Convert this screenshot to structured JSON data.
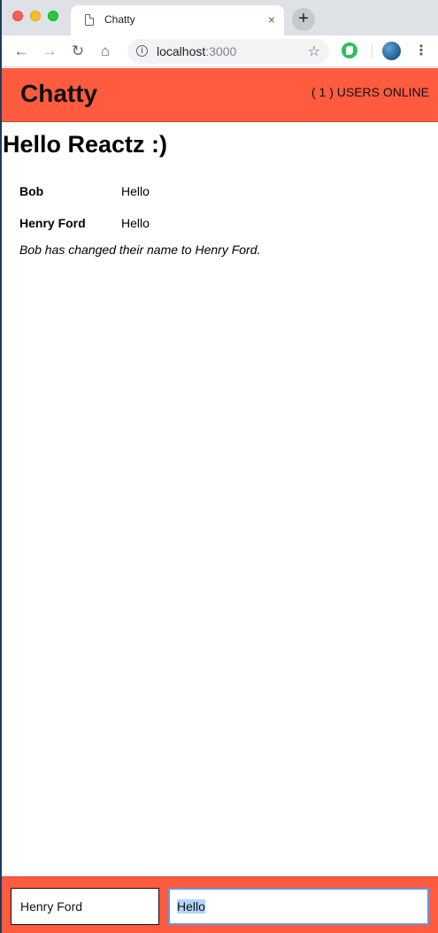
{
  "browser": {
    "tab_title": "Chatty",
    "tab_close": "×",
    "new_tab": "+",
    "url_host": "localhost",
    "url_port": ":3000"
  },
  "app": {
    "brand": "Chatty",
    "users_online": "( 1 ) USERS ONLINE",
    "heading": "Hello Reactz :)",
    "messages": [
      {
        "username": "Bob",
        "content": "Hello"
      },
      {
        "username": "Henry Ford",
        "content": "Hello"
      }
    ],
    "system_message": "Bob has changed their name to Henry Ford.",
    "chatbar": {
      "username_value": "Henry Ford",
      "message_value": "Hello"
    }
  },
  "colors": {
    "accent": "#ff5b3f",
    "focus_ring": "#6a95d8",
    "selection": "#b3d4fd"
  },
  "icons": [
    "page-icon",
    "close-icon",
    "plus-icon",
    "back-arrow-icon",
    "forward-arrow-icon",
    "reload-icon",
    "home-icon",
    "info-icon",
    "star-icon",
    "evernote-extension-icon",
    "profile-avatar-icon",
    "kebab-menu-icon"
  ]
}
